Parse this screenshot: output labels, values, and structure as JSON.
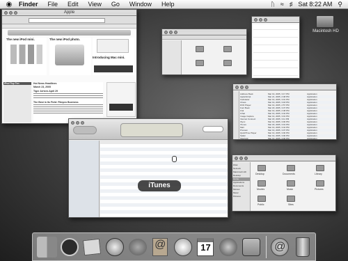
{
  "menubar": {
    "apple": "",
    "app": "Finder",
    "items": [
      "File",
      "Edit",
      "View",
      "Go",
      "Window",
      "Help"
    ],
    "clock": "Sat 8:22 AM"
  },
  "desktop": {
    "disk_label": "Macintosh HD"
  },
  "safari": {
    "title": "Apple",
    "headline_1": "The new iPod mini.",
    "headline_2": "The new iPod photo.",
    "headline_3": "Introducing Mac mini.",
    "news_heading": "Hot News Headlines",
    "date": "March 23, 2005",
    "news_1": "Tiger Arrives April 29",
    "news_2": "The Best in Its Field: Filmpro Business",
    "sidebar_heading": "iPod Top Ten"
  },
  "itunes": {
    "tooltip": "iTunes",
    "logo": ""
  },
  "app_list": {
    "rows": [
      [
        "Address Book",
        "Mar 19, 2005, 3:17 PM",
        "Application"
      ],
      [
        "AppleScript",
        "Mar 21, 2005, 2:48 PM",
        "Application"
      ],
      [
        "Calculator",
        "Mar 19, 2005, 3:01 PM",
        "Application"
      ],
      [
        "Chess",
        "Mar 19, 2005, 3:18 PM",
        "Application"
      ],
      [
        "DVD Player",
        "Mar 19, 2005, 2:57 PM",
        "Application"
      ],
      [
        "Font Book",
        "Mar 18, 2005, 3:37 PM",
        "Application"
      ],
      [
        "iCal",
        "Mar 19, 2005, 2:48 PM",
        "Application"
      ],
      [
        "iChat",
        "Mar 19, 2005, 3:42 PM",
        "Application"
      ],
      [
        "Image Capture",
        "Mar 19, 2005, 3:01 PM",
        "Application"
      ],
      [
        "Internet Connect",
        "Mar 18, 2005, 3:11 PM",
        "Application"
      ],
      [
        "iSync",
        "Mar 19, 2005, 3:00 PM",
        "Application"
      ],
      [
        "iTunes",
        "Mar 18, 2005, 3:01 PM",
        "Application"
      ],
      [
        "Mail",
        "Mar 19, 2005, 3:42 PM",
        "Application"
      ],
      [
        "Preview",
        "Mar 19, 2005, 3:07 PM",
        "Application"
      ],
      [
        "QuickTime Player",
        "Mar 19, 2005, 3:00 PM",
        "Application"
      ],
      [
        "Safari",
        "Mar 19, 2005, 3:00 PM",
        "Application"
      ],
      [
        "Sherlock",
        "Mar 19, 2005, 3:00 PM",
        "Application"
      ]
    ]
  },
  "home_window": {
    "sidebar": [
      "iDisk",
      "Network",
      "Macintosh HD",
      "Desktop",
      "Home",
      "Applications",
      "Documents",
      "Movies",
      "Music",
      "Pictures"
    ],
    "folders": [
      "Desktop",
      "Documents",
      "Library",
      "Movies",
      "Music",
      "Pictures",
      "Public",
      "Sites"
    ]
  },
  "dock": {
    "calendar_day": "17"
  }
}
